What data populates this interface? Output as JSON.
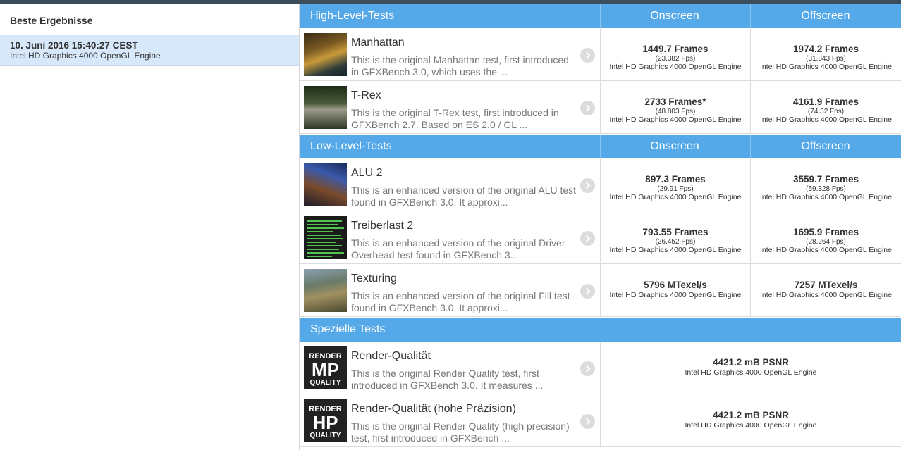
{
  "sidebar": {
    "header": "Beste Ergebnisse",
    "entry": {
      "date": "10. Juni 2016 15:40:27 CEST",
      "sub": "Intel HD Graphics 4000 OpenGL Engine"
    }
  },
  "sections": {
    "high": {
      "title": "High-Level-Tests",
      "on": "Onscreen",
      "off": "Offscreen"
    },
    "low": {
      "title": "Low-Level-Tests",
      "on": "Onscreen",
      "off": "Offscreen"
    },
    "special": {
      "title": "Spezielle Tests"
    }
  },
  "engine": "Intel HD Graphics 4000 OpenGL Engine",
  "tests": {
    "manhattan": {
      "name": "Manhattan",
      "desc": "This is the original Manhattan test, first introduced in GFXBench 3.0, which uses the ...",
      "on": {
        "val": "1449.7 Frames",
        "fps": "(23.382 Fps)"
      },
      "off": {
        "val": "1974.2 Frames",
        "fps": "(31.843 Fps)"
      }
    },
    "trex": {
      "name": "T-Rex",
      "desc": "This is the original T-Rex test, first introduced in GFXBench 2.7. Based on ES 2.0 / GL ...",
      "on": {
        "val": "2733 Frames*",
        "fps": "(48.803 Fps)"
      },
      "off": {
        "val": "4161.9 Frames",
        "fps": "(74.32 Fps)"
      }
    },
    "alu2": {
      "name": "ALU 2",
      "desc": "This is an enhanced version of the original ALU test found in GFXBench 3.0. It approxi...",
      "on": {
        "val": "897.3 Frames",
        "fps": "(29.91 Fps)"
      },
      "off": {
        "val": "3559.7 Frames",
        "fps": "(59.328 Fps)"
      }
    },
    "driver2": {
      "name": "Treiberlast 2",
      "desc": "This is an enhanced version of the original Driver Overhead test found in GFXBench 3...",
      "on": {
        "val": "793.55 Frames",
        "fps": "(26.452 Fps)"
      },
      "off": {
        "val": "1695.9 Frames",
        "fps": "(28.264 Fps)"
      }
    },
    "texturing": {
      "name": "Texturing",
      "desc": "This is an enhanced version of the original Fill test found in GFXBench 3.0. It approxi...",
      "on": {
        "val": "5796 MTexel/s"
      },
      "off": {
        "val": "7257 MTexel/s"
      }
    },
    "renderq": {
      "name": "Render-Qualität",
      "desc": "This is the original Render Quality test, first introduced in GFXBench 3.0. It measures ...",
      "val": "4421.2 mB PSNR",
      "thumb": {
        "l1": "RENDER",
        "l2": "MP",
        "l3": "QUALITY"
      }
    },
    "renderhp": {
      "name": "Render-Qualität (hohe Präzision)",
      "desc": "This is the original Render Quality (high precision) test, first introduced in GFXBench ...",
      "val": "4421.2 mB PSNR",
      "thumb": {
        "l1": "RENDER",
        "l2": "HP",
        "l3": "QUALITY"
      }
    }
  },
  "colors": {
    "accent": "#56a9e8",
    "selection": "#d6e8fa",
    "topbar": "#3c4d5c"
  },
  "icons": [
    "chevron-right-icon"
  ]
}
